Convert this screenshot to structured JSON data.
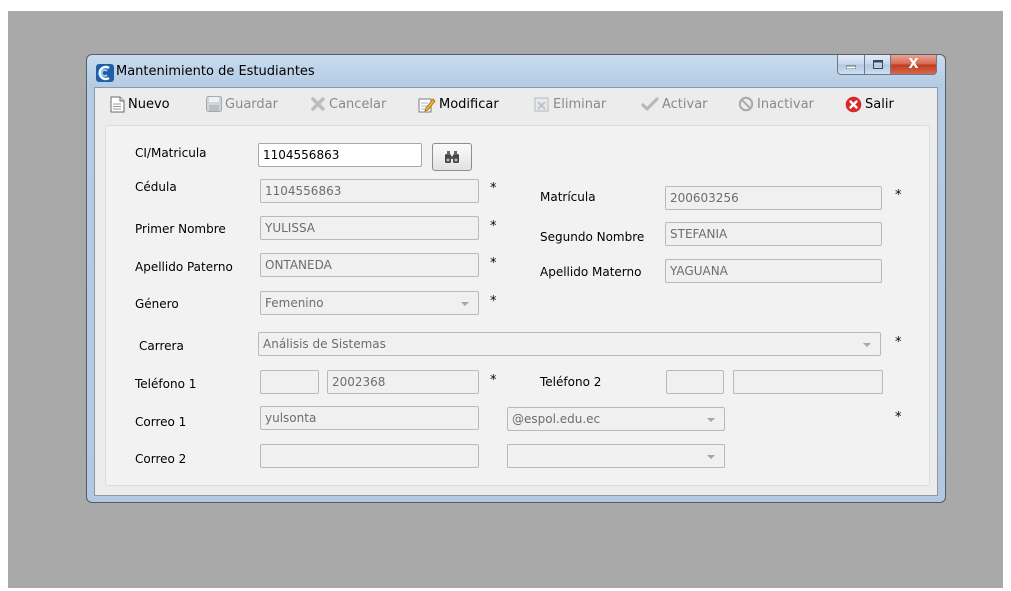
{
  "window": {
    "title": "Mantenimiento de Estudiantes",
    "close_symbol": "X"
  },
  "toolbar": {
    "nuevo": "Nuevo",
    "guardar": "Guardar",
    "cancelar": "Cancelar",
    "modificar": "Modificar",
    "eliminar": "Eliminar",
    "activar": "Activar",
    "inactivar": "Inactivar",
    "salir": "Salir"
  },
  "form": {
    "ci_matricula": {
      "label": "CI/Matricula",
      "value": "1104556863"
    },
    "cedula": {
      "label": "Cédula",
      "value": "1104556863"
    },
    "matricula": {
      "label": "Matrícula",
      "value": "200603256"
    },
    "primer_nombre": {
      "label": "Primer Nombre",
      "value": "YULISSA"
    },
    "segundo_nombre": {
      "label": "Segundo Nombre",
      "value": "STEFANIA"
    },
    "apellido_paterno": {
      "label": "Apellido Paterno",
      "value": "ONTANEDA"
    },
    "apellido_materno": {
      "label": "Apellido Materno",
      "value": "YAGUANA"
    },
    "genero": {
      "label": "Género",
      "value": "Femenino"
    },
    "carrera": {
      "label": "Carrera",
      "value": "Análisis de Sistemas"
    },
    "telefono1": {
      "label": "Teléfono 1",
      "area": "",
      "value": "2002368"
    },
    "telefono2": {
      "label": "Teléfono 2",
      "area": "",
      "value": ""
    },
    "correo1": {
      "label": "Correo 1",
      "user": "yulsonta",
      "domain": "@espol.edu.ec"
    },
    "correo2": {
      "label": "Correo 2",
      "user": "",
      "domain": ""
    },
    "required_mark": "*"
  },
  "colors": {
    "desktop": "#a9a9a9",
    "client": "#ececec",
    "titlebar": "#c9dcee",
    "close_button": "#c0391e"
  }
}
